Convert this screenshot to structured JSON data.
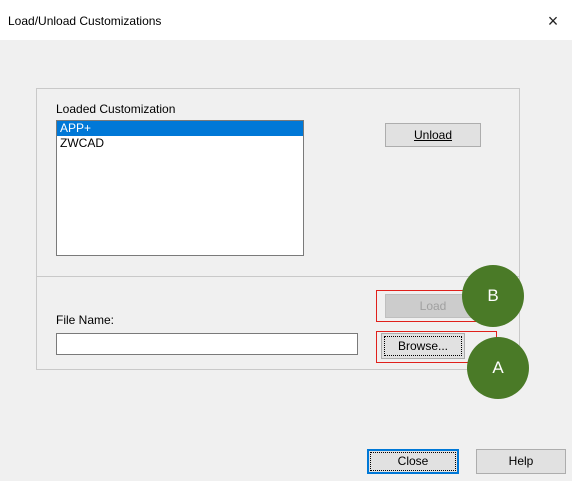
{
  "window": {
    "title": "Load/Unload Customizations",
    "close_icon": "×"
  },
  "loaded": {
    "label": "Loaded Customization",
    "items": [
      {
        "label": "APP+",
        "selected": true
      },
      {
        "label": "ZWCAD",
        "selected": false
      }
    ],
    "unload_button": "Unload"
  },
  "file": {
    "label": "File Name:",
    "value": "",
    "load_button": "Load",
    "load_enabled": false,
    "browse_button": "Browse..."
  },
  "footer": {
    "close_button": "Close",
    "help_button": "Help"
  },
  "annotations": {
    "marker_a": "A",
    "marker_b": "B",
    "marker_color": "#4a7a27",
    "frame_color": "#e0201b"
  },
  "colors": {
    "selection": "#0078d7"
  }
}
